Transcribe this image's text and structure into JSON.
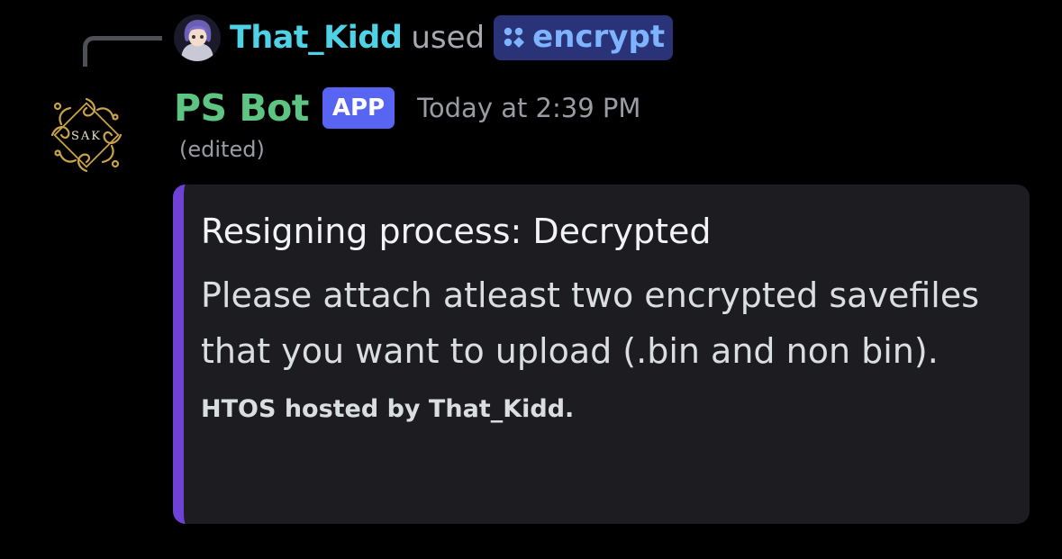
{
  "reply": {
    "username": "That_Kidd",
    "used_text": "used",
    "command": {
      "icon": "apps-icon",
      "label": "encrypt"
    }
  },
  "message": {
    "author": "PS Bot",
    "badge": "APP",
    "timestamp": "Today at 2:39 PM",
    "edited": "(edited)",
    "avatar_text": "SAK"
  },
  "embed": {
    "title": "Resigning process: Decrypted",
    "description": "Please attach atleast two encrypted savefiles that you want to upload (.bin and non bin).",
    "footer": "HTOS hosted by That_Kidd."
  },
  "colors": {
    "background": "#000000",
    "reply_username": "#4fd1e6",
    "command_pill_bg": "#2b3378",
    "command_text": "#7db3ff",
    "bot_name": "#5dc482",
    "app_badge": "#5865f2",
    "embed_bg": "#1c1c21",
    "embed_accent": "#6f42d6"
  }
}
